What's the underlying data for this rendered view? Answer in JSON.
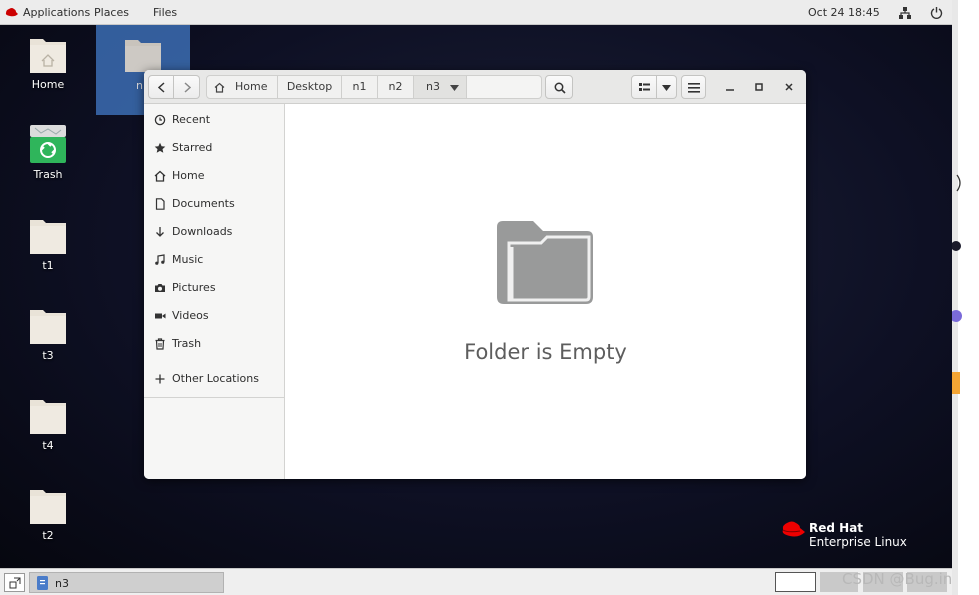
{
  "topbar": {
    "applications": "Applications",
    "places": "Places",
    "files": "Files",
    "clock": "Oct 24  18:45",
    "network_icon": "network-icon",
    "power_icon": "power-icon"
  },
  "desktop": {
    "icons": [
      {
        "label": "Home",
        "kind": "home-folder"
      },
      {
        "label": "Trash",
        "kind": "trash"
      },
      {
        "label": "t1",
        "kind": "folder"
      },
      {
        "label": "t3",
        "kind": "folder"
      },
      {
        "label": "t4",
        "kind": "folder"
      },
      {
        "label": "t2",
        "kind": "folder"
      }
    ],
    "selected_icon_label": "n"
  },
  "window": {
    "breadcrumbs": [
      "Home",
      "Desktop",
      "n1",
      "n2",
      "n3"
    ],
    "sidebar": {
      "items": [
        {
          "label": "Recent",
          "icon": "clock-icon"
        },
        {
          "label": "Starred",
          "icon": "star-icon"
        },
        {
          "label": "Home",
          "icon": "home-icon"
        },
        {
          "label": "Documents",
          "icon": "document-icon"
        },
        {
          "label": "Downloads",
          "icon": "download-icon"
        },
        {
          "label": "Music",
          "icon": "music-icon"
        },
        {
          "label": "Pictures",
          "icon": "camera-icon"
        },
        {
          "label": "Videos",
          "icon": "video-icon"
        },
        {
          "label": "Trash",
          "icon": "trash-icon"
        }
      ],
      "other_locations": "Other Locations"
    },
    "empty_message": "Folder is Empty"
  },
  "taskbar": {
    "task_label": "n3"
  },
  "branding": {
    "line1": "Red Hat",
    "line2": "Enterprise Linux"
  },
  "watermark": "CSDN @Bug.ink",
  "colors": {
    "accent": "#3b6db3",
    "redhat_red": "#ee0000",
    "folder": "#e9e3d8"
  }
}
